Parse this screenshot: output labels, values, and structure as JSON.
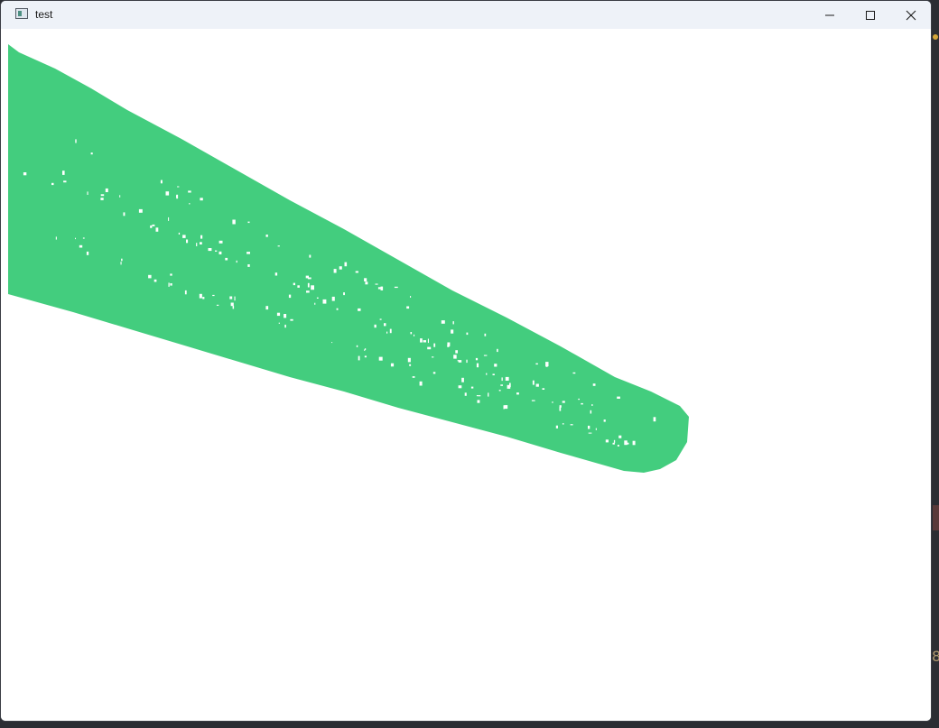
{
  "window": {
    "title": "test"
  },
  "titlebar": {
    "icon": "app-window-icon",
    "controls": [
      {
        "name": "minimize-icon"
      },
      {
        "name": "maximize-icon"
      },
      {
        "name": "close-icon"
      }
    ]
  },
  "scene": {
    "shape_color": "#43cd7e",
    "background_color": "#ffffff"
  },
  "background": {
    "edge_char": "8"
  }
}
